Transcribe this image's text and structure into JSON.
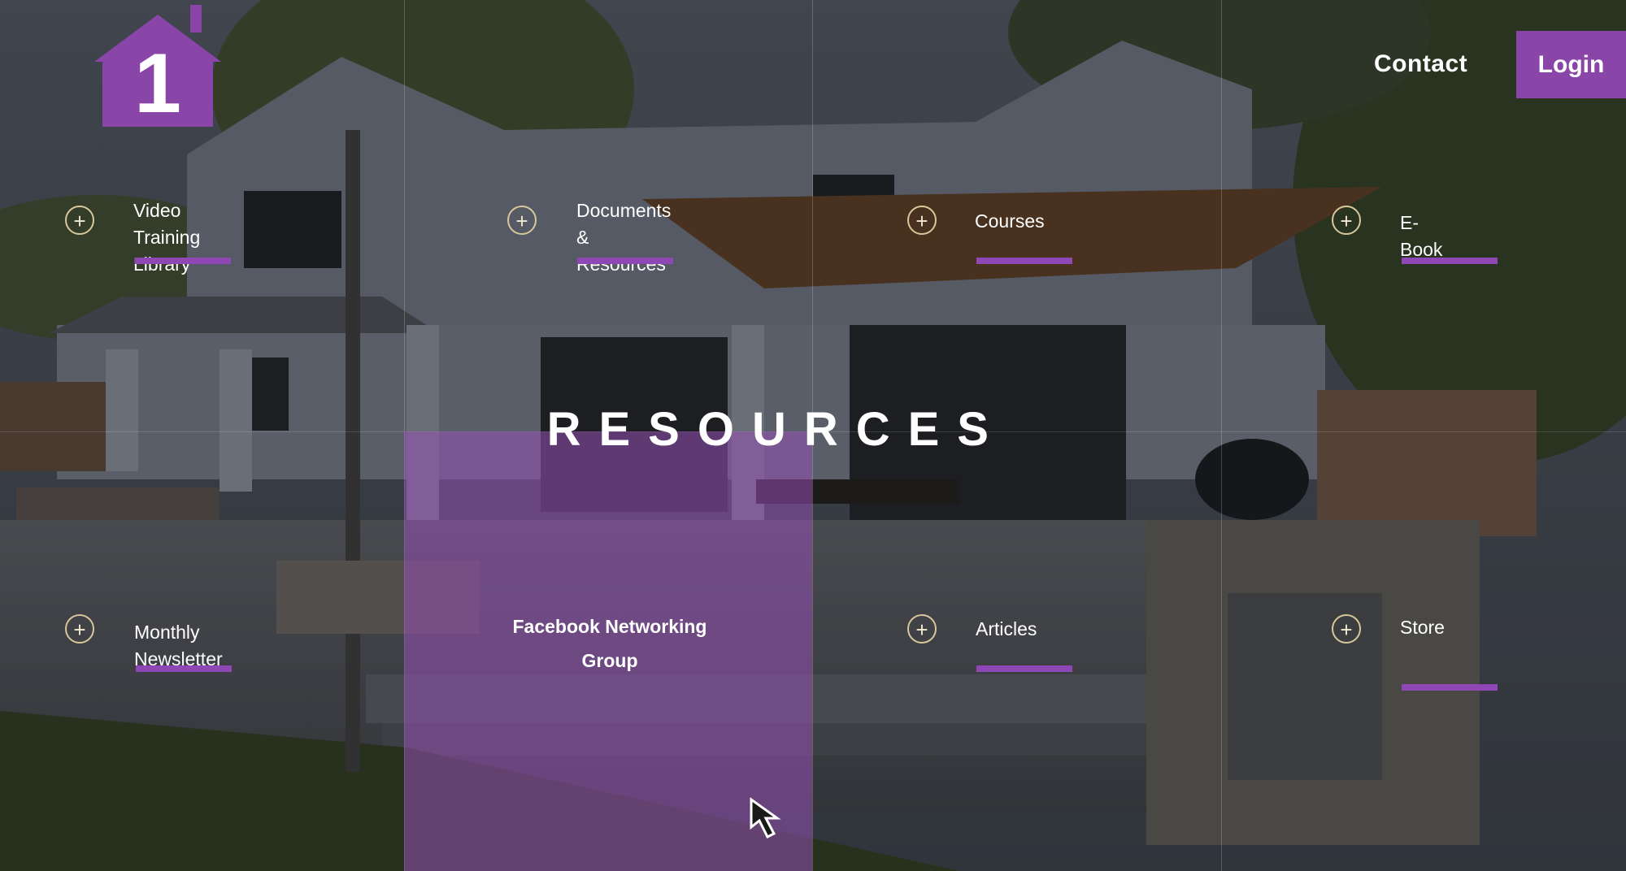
{
  "header": {
    "logo_text": "1",
    "contact_label": "Contact",
    "login_label": "Login"
  },
  "hero": {
    "title": "RESOURCES"
  },
  "items": [
    {
      "label": "Video Training\nLibrary"
    },
    {
      "label": "Documents\n& Resources"
    },
    {
      "label": "Courses"
    },
    {
      "label": "E-Book"
    },
    {
      "label": "Monthly Newsletter"
    },
    {
      "label": "Facebook Networking\nGroup"
    },
    {
      "label": "Articles"
    },
    {
      "label": "Store"
    }
  ],
  "icons": {
    "plus": "+"
  },
  "colors": {
    "accent": "#8a45a8",
    "underline": "#8f47b6",
    "highlight": "#9650b4"
  }
}
